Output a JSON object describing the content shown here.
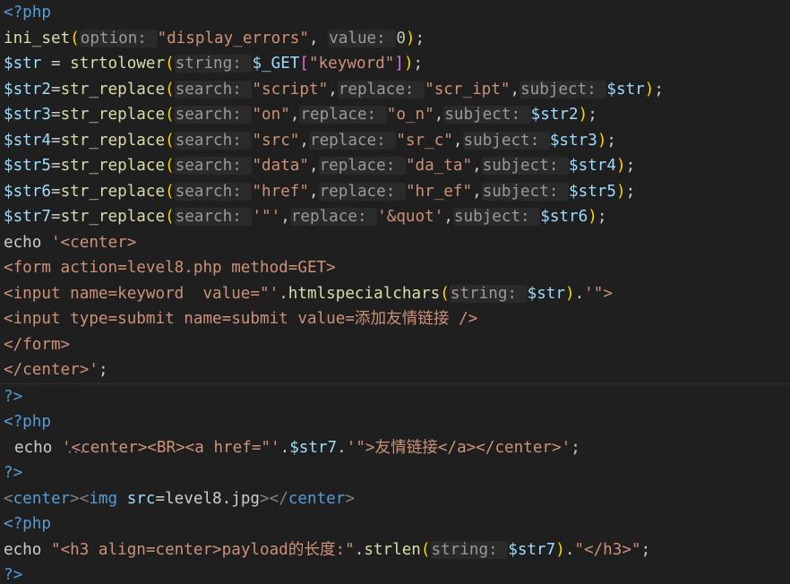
{
  "colors": {
    "background": "#1f1f1f",
    "php_tag": "#569cd6",
    "function": "#dcdcaa",
    "variable": "#9cdcfe",
    "string": "#ce9178",
    "plain": "#cccccc",
    "inlay_hint": "#9a9a9a",
    "bracket_gold": "#ffd700",
    "bracket_pink": "#da70d6",
    "html_tag": "#569cd6",
    "html_attr": "#9cdcfe"
  },
  "lines": [
    [
      {
        "t": "<?php",
        "c": "#569cd6"
      }
    ],
    [
      {
        "t": "ini_set",
        "c": "#dcdcaa"
      },
      {
        "t": "(",
        "c": "#ffd700"
      },
      {
        "t": "option: ",
        "h": true
      },
      {
        "t": "\"display_errors\"",
        "c": "#ce9178"
      },
      {
        "t": ", ",
        "c": "#cccccc"
      },
      {
        "t": "value: ",
        "h": true
      },
      {
        "t": "0",
        "c": "#b5cea8"
      },
      {
        "t": ")",
        "c": "#ffd700"
      },
      {
        "t": ";",
        "c": "#cccccc"
      }
    ],
    [
      {
        "t": "$str",
        "c": "#9cdcfe"
      },
      {
        "t": " = ",
        "c": "#cccccc"
      },
      {
        "t": "strtolower",
        "c": "#dcdcaa"
      },
      {
        "t": "(",
        "c": "#ffd700"
      },
      {
        "t": "string: ",
        "h": true
      },
      {
        "t": "$_GET",
        "c": "#9cdcfe"
      },
      {
        "t": "[",
        "c": "#da70d6"
      },
      {
        "t": "\"keyword\"",
        "c": "#ce9178"
      },
      {
        "t": "]",
        "c": "#da70d6"
      },
      {
        "t": ")",
        "c": "#ffd700"
      },
      {
        "t": ";",
        "c": "#cccccc"
      }
    ],
    [
      {
        "t": "$str2",
        "c": "#9cdcfe"
      },
      {
        "t": "=",
        "c": "#cccccc"
      },
      {
        "t": "str_replace",
        "c": "#dcdcaa"
      },
      {
        "t": "(",
        "c": "#ffd700"
      },
      {
        "t": "search: ",
        "h": true
      },
      {
        "t": "\"script\"",
        "c": "#ce9178"
      },
      {
        "t": ",",
        "c": "#cccccc"
      },
      {
        "t": "replace: ",
        "h": true
      },
      {
        "t": "\"scr_ipt\"",
        "c": "#ce9178"
      },
      {
        "t": ",",
        "c": "#cccccc"
      },
      {
        "t": "subject: ",
        "h": true
      },
      {
        "t": "$str",
        "c": "#9cdcfe"
      },
      {
        "t": ")",
        "c": "#ffd700"
      },
      {
        "t": ";",
        "c": "#cccccc"
      }
    ],
    [
      {
        "t": "$str3",
        "c": "#9cdcfe"
      },
      {
        "t": "=",
        "c": "#cccccc"
      },
      {
        "t": "str_replace",
        "c": "#dcdcaa"
      },
      {
        "t": "(",
        "c": "#ffd700"
      },
      {
        "t": "search: ",
        "h": true
      },
      {
        "t": "\"on\"",
        "c": "#ce9178"
      },
      {
        "t": ",",
        "c": "#cccccc"
      },
      {
        "t": "replace: ",
        "h": true
      },
      {
        "t": "\"o_n\"",
        "c": "#ce9178"
      },
      {
        "t": ",",
        "c": "#cccccc"
      },
      {
        "t": "subject: ",
        "h": true
      },
      {
        "t": "$str2",
        "c": "#9cdcfe"
      },
      {
        "t": ")",
        "c": "#ffd700"
      },
      {
        "t": ";",
        "c": "#cccccc"
      }
    ],
    [
      {
        "t": "$str4",
        "c": "#9cdcfe"
      },
      {
        "t": "=",
        "c": "#cccccc"
      },
      {
        "t": "str_replace",
        "c": "#dcdcaa"
      },
      {
        "t": "(",
        "c": "#ffd700"
      },
      {
        "t": "search: ",
        "h": true
      },
      {
        "t": "\"src\"",
        "c": "#ce9178"
      },
      {
        "t": ",",
        "c": "#cccccc"
      },
      {
        "t": "replace: ",
        "h": true
      },
      {
        "t": "\"sr_c\"",
        "c": "#ce9178"
      },
      {
        "t": ",",
        "c": "#cccccc"
      },
      {
        "t": "subject: ",
        "h": true
      },
      {
        "t": "$str3",
        "c": "#9cdcfe"
      },
      {
        "t": ")",
        "c": "#ffd700"
      },
      {
        "t": ";",
        "c": "#cccccc"
      }
    ],
    [
      {
        "t": "$str5",
        "c": "#9cdcfe"
      },
      {
        "t": "=",
        "c": "#cccccc"
      },
      {
        "t": "str_replace",
        "c": "#dcdcaa"
      },
      {
        "t": "(",
        "c": "#ffd700"
      },
      {
        "t": "search: ",
        "h": true
      },
      {
        "t": "\"data\"",
        "c": "#ce9178"
      },
      {
        "t": ",",
        "c": "#cccccc"
      },
      {
        "t": "replace: ",
        "h": true
      },
      {
        "t": "\"da_ta\"",
        "c": "#ce9178"
      },
      {
        "t": ",",
        "c": "#cccccc"
      },
      {
        "t": "subject: ",
        "h": true
      },
      {
        "t": "$str4",
        "c": "#9cdcfe"
      },
      {
        "t": ")",
        "c": "#ffd700"
      },
      {
        "t": ";",
        "c": "#cccccc"
      }
    ],
    [
      {
        "t": "$str6",
        "c": "#9cdcfe"
      },
      {
        "t": "=",
        "c": "#cccccc"
      },
      {
        "t": "str_replace",
        "c": "#dcdcaa"
      },
      {
        "t": "(",
        "c": "#ffd700"
      },
      {
        "t": "search: ",
        "h": true
      },
      {
        "t": "\"href\"",
        "c": "#ce9178"
      },
      {
        "t": ",",
        "c": "#cccccc"
      },
      {
        "t": "replace: ",
        "h": true
      },
      {
        "t": "\"hr_ef\"",
        "c": "#ce9178"
      },
      {
        "t": ",",
        "c": "#cccccc"
      },
      {
        "t": "subject: ",
        "h": true
      },
      {
        "t": "$str5",
        "c": "#9cdcfe"
      },
      {
        "t": ")",
        "c": "#ffd700"
      },
      {
        "t": ";",
        "c": "#cccccc"
      }
    ],
    [
      {
        "t": "$str7",
        "c": "#9cdcfe"
      },
      {
        "t": "=",
        "c": "#cccccc"
      },
      {
        "t": "str_replace",
        "c": "#dcdcaa"
      },
      {
        "t": "(",
        "c": "#ffd700"
      },
      {
        "t": "search: ",
        "h": true
      },
      {
        "t": "'\"'",
        "c": "#ce9178"
      },
      {
        "t": ",",
        "c": "#cccccc"
      },
      {
        "t": "replace: ",
        "h": true
      },
      {
        "t": "'&quot'",
        "c": "#ce9178"
      },
      {
        "t": ",",
        "c": "#cccccc"
      },
      {
        "t": "subject: ",
        "h": true
      },
      {
        "t": "$str6",
        "c": "#9cdcfe"
      },
      {
        "t": ")",
        "c": "#ffd700"
      },
      {
        "t": ";",
        "c": "#cccccc"
      }
    ],
    [
      {
        "t": "echo ",
        "c": "#cccccc"
      },
      {
        "t": "'<center>",
        "c": "#ce9178"
      }
    ],
    [
      {
        "t": "<form action=level8.php method=GET>",
        "c": "#ce9178"
      }
    ],
    [
      {
        "t": "<input name=keyword  value=\"'",
        "c": "#ce9178"
      },
      {
        "t": ".",
        "c": "#cccccc"
      },
      {
        "t": "htmlspecialchars",
        "c": "#dcdcaa"
      },
      {
        "t": "(",
        "c": "#ffd700"
      },
      {
        "t": "string: ",
        "h": true
      },
      {
        "t": "$str",
        "c": "#9cdcfe"
      },
      {
        "t": ")",
        "c": "#ffd700"
      },
      {
        "t": ".",
        "c": "#cccccc"
      },
      {
        "t": "'\">",
        "c": "#ce9178"
      }
    ],
    [
      {
        "t": "<input type=submit name=submit value=添加友情链接 />",
        "c": "#ce9178"
      }
    ],
    [
      {
        "t": "</form>",
        "c": "#ce9178"
      }
    ],
    [
      {
        "t": "</center>'",
        "c": "#ce9178"
      },
      {
        "t": ";",
        "c": "#cccccc"
      }
    ],
    [
      {
        "t": "?>",
        "c": "#569cd6"
      }
    ],
    [
      {
        "t": "<?php",
        "c": "#569cd6"
      }
    ],
    [
      {
        "t": "echo ",
        "c": "#cccccc"
      },
      {
        "t": "'<center><BR><a href=\"'",
        "c": "#ce9178"
      },
      {
        "t": ".",
        "c": "#cccccc"
      },
      {
        "t": "$str7",
        "c": "#9cdcfe"
      },
      {
        "t": ".",
        "c": "#cccccc"
      },
      {
        "t": "'\">友情链接</a></center>'",
        "c": "#ce9178"
      },
      {
        "t": ";",
        "c": "#cccccc"
      }
    ],
    [
      {
        "t": "?>",
        "c": "#569cd6"
      }
    ],
    [
      {
        "t": "<",
        "c": "#808080"
      },
      {
        "t": "center",
        "c": "#569cd6"
      },
      {
        "t": "><",
        "c": "#808080"
      },
      {
        "t": "img",
        "c": "#569cd6"
      },
      {
        "t": " ",
        "c": "#cccccc"
      },
      {
        "t": "src",
        "c": "#9cdcfe"
      },
      {
        "t": "=level8.jpg",
        "c": "#cccccc"
      },
      {
        "t": "></",
        "c": "#808080"
      },
      {
        "t": "center",
        "c": "#569cd6"
      },
      {
        "t": ">",
        "c": "#808080"
      }
    ],
    [
      {
        "t": "<?php",
        "c": "#569cd6"
      }
    ],
    [
      {
        "t": "echo ",
        "c": "#cccccc"
      },
      {
        "t": "\"<h3 align=center>payload的长度:\"",
        "c": "#ce9178"
      },
      {
        "t": ".",
        "c": "#cccccc"
      },
      {
        "t": "strlen",
        "c": "#dcdcaa"
      },
      {
        "t": "(",
        "c": "#ffd700"
      },
      {
        "t": "string: ",
        "h": true
      },
      {
        "t": "$str7",
        "c": "#9cdcfe"
      },
      {
        "t": ")",
        "c": "#ffd700"
      },
      {
        "t": ".",
        "c": "#cccccc"
      },
      {
        "t": "\"</h3>\"",
        "c": "#ce9178"
      },
      {
        "t": ";",
        "c": "#cccccc"
      }
    ],
    [
      {
        "t": "?>",
        "c": "#569cd6"
      }
    ]
  ]
}
